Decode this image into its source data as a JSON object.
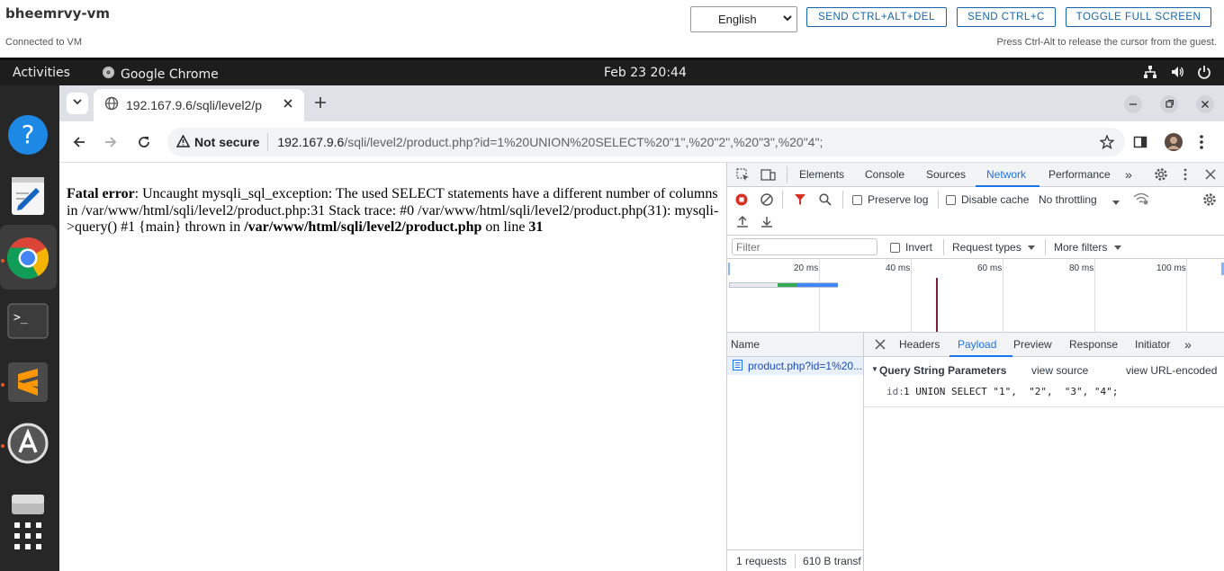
{
  "vm": {
    "title": "bheemrvy-vm",
    "status": "Connected to VM",
    "language": "English",
    "buttons": [
      "SEND CTRL+ALT+DEL",
      "SEND CTRL+C",
      "TOGGLE FULL SCREEN"
    ],
    "hint": "Press Ctrl-Alt to release the cursor from the guest."
  },
  "ubuntu": {
    "activities": "Activities",
    "app_name": "Google Chrome",
    "clock": "Feb 23  20:44"
  },
  "chrome": {
    "tab_title": "192.167.9.6/sqli/level2/p",
    "security_label": "Not secure",
    "url_host": "192.167.9.6",
    "url_path": "/sqli/level2/product.php?id=1%20UNION%20SELECT%20\"1\",%20\"2\",%20\"3\",%20\"4\";"
  },
  "page": {
    "error_label": "Fatal error",
    "error_message": ": Uncaught mysqli_sql_exception: The used SELECT statements have a different number of columns in /var/www/html/sqli/level2/product.php:31 Stack trace: #0 /var/www/html/sqli/level2/product.php(31): mysqli->query() #1 {main} thrown in ",
    "error_file": "/var/www/html/sqli/level2/product.php",
    "error_online": " on line ",
    "error_line": "31"
  },
  "devtools": {
    "tabs": [
      "Elements",
      "Console",
      "Sources",
      "Network",
      "Performance"
    ],
    "active_tab": "Network",
    "preserve_log": "Preserve log",
    "disable_cache": "Disable cache",
    "throttling": "No throttling",
    "filter_placeholder": "Filter",
    "invert": "Invert",
    "request_types": "Request types",
    "more_filters": "More filters",
    "timeline_ticks": [
      "20 ms",
      "40 ms",
      "60 ms",
      "80 ms",
      "100 ms"
    ],
    "name_header": "Name",
    "request_name": "product.php?id=1%20...",
    "detail_tabs": [
      "Headers",
      "Payload",
      "Preview",
      "Response",
      "Initiator"
    ],
    "active_detail_tab": "Payload",
    "qsp_title": "Query String Parameters",
    "view_source": "view source",
    "view_url_encoded": "view URL-encoded",
    "param_key": "id:",
    "param_value": "1 UNION SELECT \"1\",  \"2\",  \"3\", \"4\";",
    "status_requests": "1 requests",
    "status_transferred": "610 B transf"
  }
}
